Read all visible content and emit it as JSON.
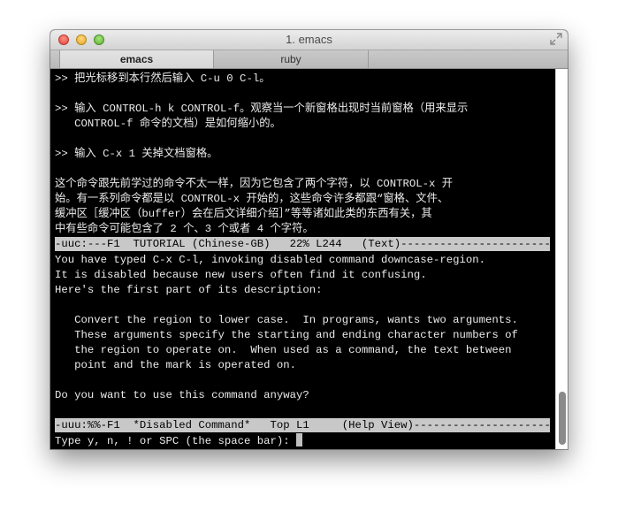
{
  "window": {
    "title": "1. emacs"
  },
  "tabs": [
    {
      "label": "emacs",
      "active": true
    },
    {
      "label": "ruby",
      "active": false
    }
  ],
  "icons": {
    "close": "close-icon",
    "minimize": "minimize-icon",
    "zoom": "zoom-icon",
    "fullscreen": "fullscreen-icon"
  },
  "colors": {
    "terminal_bg": "#000000",
    "terminal_fg": "#ebebeb",
    "modeline_bg": "#c8c8c8",
    "cursor": "#bfbfbf"
  },
  "tutorial_lines": [
    ">> 把光标移到本行然后输入 C-u 0 C-l。",
    "",
    ">> 输入 CONTROL-h k CONTROL-f。观察当一个新窗格出现时当前窗格（用来显示",
    "   CONTROL-f 命令的文档）是如何缩小的。",
    "",
    ">> 输入 C-x 1 关掉文档窗格。",
    "",
    "这个命令跟先前学过的命令不太一样，因为它包含了两个字符，以 CONTROL-x 开",
    "始。有一系列命令都是以 CONTROL-x 开始的，这些命令许多都跟“窗格、文件、",
    "缓冲区［缓冲区（buffer）会在后文详细介绍］”等等诸如此类的东西有关，其",
    "中有些命令可能包含了 2 个、3 个或者 4 个字符。"
  ],
  "modeline_top": "-uuc:---F1  TUTORIAL (Chinese-GB)   22% L244   (Text)--------------------------------------",
  "help_lines": [
    "You have typed C-x C-l, invoking disabled command downcase-region.",
    "It is disabled because new users often find it confusing.",
    "Here's the first part of its description:",
    "",
    "   Convert the region to lower case.  In programs, wants two arguments.",
    "   These arguments specify the starting and ending character numbers of",
    "   the region to operate on.  When used as a command, the text between",
    "   point and the mark is operated on.",
    "",
    "Do you want to use this command anyway?"
  ],
  "modeline_bottom": "-uuu:%%-F1  *Disabled Command*   Top L1     (Help View)--------------------------------------",
  "minibuffer": {
    "prompt": "Type y, n, ! or SPC (the space bar): "
  }
}
